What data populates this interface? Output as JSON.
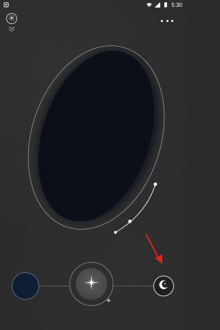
{
  "status_bar": {
    "time": "5:30",
    "icons": [
      "notification-icon",
      "wifi-icon",
      "signal-icon",
      "battery-icon"
    ]
  },
  "toolbar": {
    "left_icon": "sun-settings-icon",
    "chevron_icon": "chevron-down-icon",
    "menu_icon": "more-dots-icon"
  },
  "colors": {
    "background": "#2b2b2b",
    "ellipse_fill": "#0b0f17",
    "swatch_color": "#0f1e33",
    "annotation_arrow": "#e0201a"
  },
  "controls": {
    "swatch_label": "",
    "center_icon": "star-icon",
    "moon_icon": "moon-star-icon"
  }
}
